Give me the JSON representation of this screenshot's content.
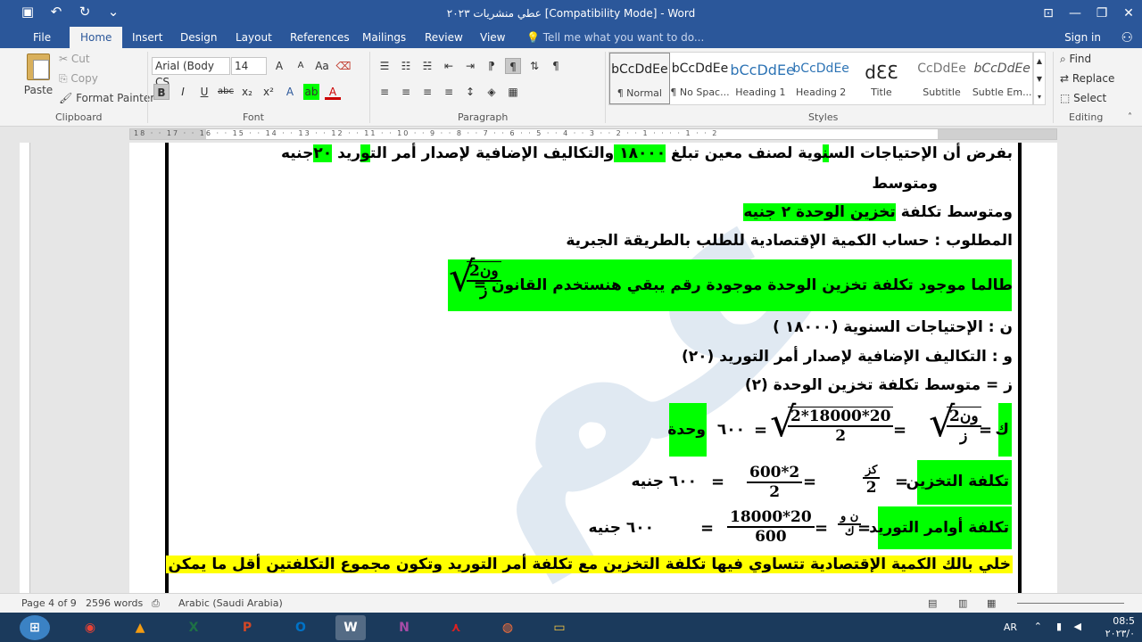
{
  "titlebar": {
    "title": "عطي منشريات ٢٠٢٣ [Compatibility Mode] - Word",
    "qat": [
      "save-icon",
      "undo-icon",
      "redo-icon",
      "customize-qat-icon"
    ],
    "controls": [
      "ribbon-display-icon",
      "minimize-icon",
      "restore-icon",
      "close-icon"
    ]
  },
  "menu": {
    "tabs": [
      "File",
      "Home",
      "Insert",
      "Design",
      "Layout",
      "References",
      "Mailings",
      "Review",
      "View"
    ],
    "active": "Home",
    "tell_me": "Tell me what you want to do...",
    "sign_in": "Sign in"
  },
  "ribbon": {
    "clipboard": {
      "paste": "Paste",
      "cut": "Cut",
      "copy": "Copy",
      "format_painter": "Format Painter",
      "label": "Clipboard"
    },
    "font": {
      "name": "Arial (Body CS",
      "size": "14",
      "label": "Font",
      "grow": "A",
      "shrink": "A",
      "case": "Aa",
      "bold": "B",
      "italic": "I",
      "underline": "U",
      "strike": "abc",
      "sub": "x₂",
      "sup": "x²"
    },
    "paragraph": {
      "label": "Paragraph",
      "pilcrow": "¶"
    },
    "styles": {
      "label": "Styles",
      "items": [
        {
          "preview": "bCcDdEe",
          "name": "¶ Normal"
        },
        {
          "preview": "bCcDdEe",
          "name": "¶ No Spac..."
        },
        {
          "preview": "bCcDdEe",
          "name": "Heading 1"
        },
        {
          "preview": "bCcDdEe",
          "name": "Heading 2"
        },
        {
          "preview": "dƐƐ",
          "name": "Title"
        },
        {
          "preview": "CcDdEe",
          "name": "Subtitle"
        },
        {
          "preview": "bCcDdEe",
          "name": "Subtle Em..."
        }
      ]
    },
    "editing": {
      "label": "Editing",
      "find": "Find",
      "replace": "Replace",
      "select": "Select"
    }
  },
  "ruler": {
    "ticks": "18 · · 17 · · 16 · · 15 · · 14 · · 13 · · 12 · · 11 · · 10 · · 9 · · 8 · · 7 · · 6 · · 5 · · 4 · · 3 · · 2 · · 1 · · · · 1 · · 2"
  },
  "document": {
    "watermark": "عم",
    "line1": {
      "before": "بفرض أن الإحتياجات الس",
      "h1": "ن",
      "mid1": "وية لصنف معين تبلغ ",
      "h2": " ١٨٠٠٠ ",
      "mid2": " والتكاليف الإضافية لإصدار أمر الت",
      "h3": "و",
      "mid3": "ريد ",
      "h4": "٢٠",
      "after": "جنيه"
    },
    "line1b": "ومتوسط",
    "line2": {
      "before": "ومتوسط تكلفة ",
      "highlight": "تخزين الوحدة ٢ جنيه"
    },
    "line3": "المطلوب : حساب الكمية الإقتصادية للطلب بالطريقة الجبرية",
    "line4": "طالما موجود تكلفة تخزين الوحدة موجودة رقم يبقي هنستخدم القانون  =",
    "formula_sqrt": {
      "num": "2ون",
      "den": "ز"
    },
    "def_n": "ن : الإحتياجات السنوية (١٨٠٠٠ )",
    "def_w": "و : التكاليف الإضافية لإصدار أمر التوريد (٢٠)",
    "def_z": "ز = متوسط تكلفة تخزين الوحدة (٢)",
    "k_label": "ك",
    "k_eq1": "=",
    "k_formula": {
      "num": "2ون",
      "den": "ز"
    },
    "k_eq2": "=",
    "k_formula2": {
      "num": "2*18000*20",
      "den": "2"
    },
    "k_eq3": "=",
    "k_result": "٦٠٠",
    "k_unit": "وحدة",
    "storage_label": "تكلفة التخزين",
    "storage_eq1": "=",
    "storage_f1": {
      "num": "كز",
      "den": "2"
    },
    "storage_eq2": "=",
    "storage_f2": {
      "num": "600*2",
      "den": "2"
    },
    "storage_eq3": "=",
    "storage_result": "٦٠٠ جنيه",
    "order_label": "تكلفة أوامر التوريد",
    "order_eq1": "=",
    "order_f1": {
      "num": "ن و",
      "den": "ك"
    },
    "order_eq2": "=",
    "order_f2": {
      "num": "18000*20",
      "den": "600"
    },
    "order_eq3": "=",
    "order_result": "٦٠٠ جنيه",
    "line_last": "خلي بالك الكمية الإقتصادية تتساوي فيها تكلفة التخزين مع تكلفة أمر التوريد وتكون مجموع التكلفتين أقل ما يمكن"
  },
  "status": {
    "page": "Page 4 of 9",
    "words": "2596 words",
    "language": "Arabic (Saudi Arabia)"
  },
  "taskbar": {
    "apps": [
      "start-icon",
      "chrome-icon",
      "vlc-icon",
      "excel-icon",
      "powerpoint-icon",
      "outlook-icon",
      "word-icon",
      "onenote-icon",
      "acrobat-icon",
      "firefox-icon",
      "explorer-icon"
    ],
    "lang": "AR",
    "time": "08:5",
    "date": "٢٠٢٣/٠"
  }
}
